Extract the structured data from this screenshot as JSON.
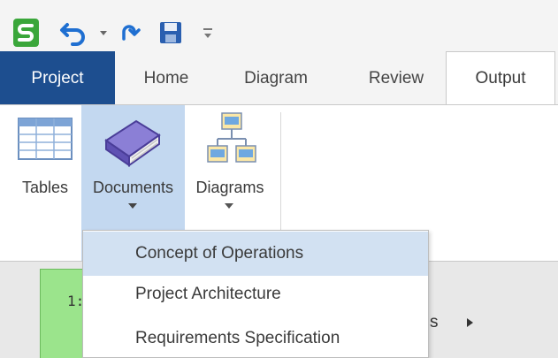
{
  "quick_access": {
    "icons": [
      "app-logo-icon",
      "undo-icon",
      "chevron-down-icon",
      "redo-icon",
      "save-icon",
      "customize-icon"
    ],
    "colors": {
      "app_logo": "#3aa63a",
      "undo": "#1f6fd1",
      "save": "#2a5fb0"
    }
  },
  "tabs": [
    {
      "label": "Project",
      "active": false,
      "highlighted": true
    },
    {
      "label": "Home",
      "active": false
    },
    {
      "label": "Diagram",
      "active": false
    },
    {
      "label": "Review",
      "active": false
    },
    {
      "label": "Output",
      "active": true
    }
  ],
  "ribbon": {
    "buttons": [
      {
        "label": "Tables",
        "icon": "table-grid-icon",
        "has_dropdown": false
      },
      {
        "label": "Documents",
        "icon": "book-icon",
        "has_dropdown": true,
        "pressed": true
      },
      {
        "label": "Diagrams",
        "icon": "diagram-icon",
        "has_dropdown": true
      }
    ]
  },
  "documents_menu": {
    "items": [
      {
        "label": "Concept of Operations",
        "hovered": true
      },
      {
        "label": "Project Architecture"
      },
      {
        "label": "Requirements Specification"
      }
    ]
  },
  "workspace": {
    "node_label": "1:",
    "trailing_text": "s",
    "colors": {
      "node": "#9be48c",
      "background": "#e8e8e8"
    }
  },
  "colors": {
    "project_tab": "#1d4e8f",
    "pressed_button": "#c3d8f0",
    "hovered_item": "#d2e1f2"
  }
}
